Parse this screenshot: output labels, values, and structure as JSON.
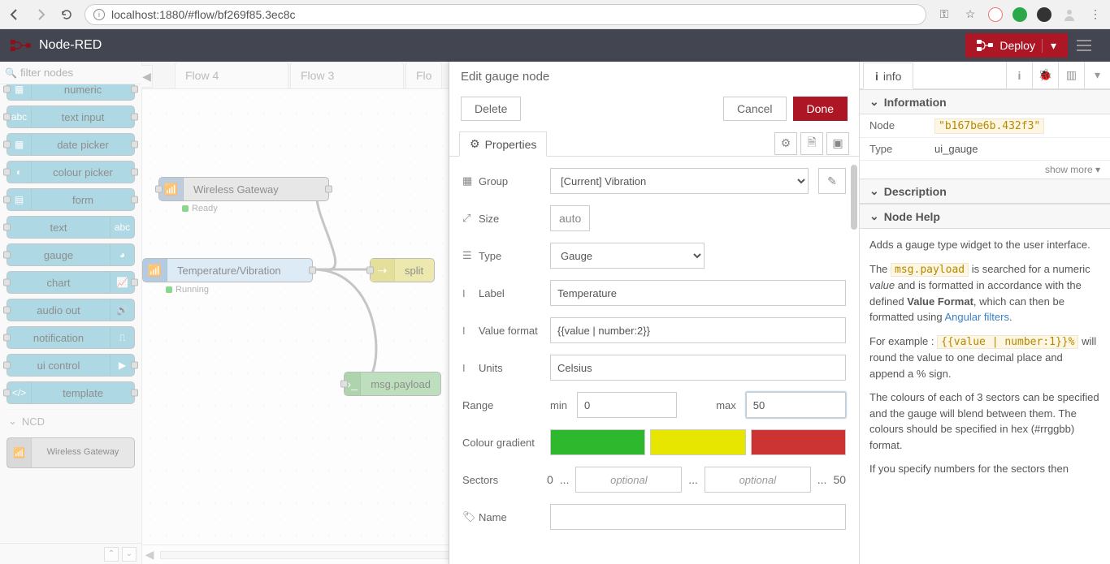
{
  "browser": {
    "url": "localhost:1880/#flow/bf269f85.3ec8c"
  },
  "header": {
    "title": "Node-RED",
    "deploy": "Deploy"
  },
  "palette": {
    "filter_placeholder": "filter nodes",
    "items": [
      {
        "label": "numeric"
      },
      {
        "label": "text input"
      },
      {
        "label": "date picker"
      },
      {
        "label": "colour picker"
      },
      {
        "label": "form"
      },
      {
        "label": "text"
      },
      {
        "label": "gauge"
      },
      {
        "label": "chart"
      },
      {
        "label": "audio out"
      },
      {
        "label": "notification"
      },
      {
        "label": "ui control"
      },
      {
        "label": "template"
      }
    ],
    "cat_ncd": "NCD",
    "ncd_item": "Wireless Gateway"
  },
  "tabs": [
    {
      "label": "Flow 4"
    },
    {
      "label": "Flow 3"
    },
    {
      "label": "Flo"
    }
  ],
  "flow_nodes": {
    "gateway": {
      "label": "Wireless Gateway",
      "status": "Ready"
    },
    "temp": {
      "label": "Temperature/Vibration",
      "status": "Running"
    },
    "split": {
      "label": "split"
    },
    "msgpayload": {
      "label": "msg.payload"
    }
  },
  "tray": {
    "title": "Edit gauge node",
    "delete": "Delete",
    "cancel": "Cancel",
    "done": "Done",
    "properties": "Properties",
    "fields": {
      "group_label": "Group",
      "group_value": "[Current] Vibration",
      "size_label": "Size",
      "size_value": "auto",
      "type_label": "Type",
      "type_value": "Gauge",
      "label_label": "Label",
      "label_value": "Temperature",
      "vf_label": "Value format",
      "vf_value": "{{value | number:2}}",
      "units_label": "Units",
      "units_value": "Celsius",
      "range_label": "Range",
      "min_label": "min",
      "min_value": "0",
      "max_label": "max",
      "max_value": "50",
      "cg_label": "Colour gradient",
      "colors": [
        "#2eb82e",
        "#e6e600",
        "#cc3333"
      ],
      "sectors_label": "Sectors",
      "sectors_start": "0",
      "sectors_end": "50",
      "sectors_placeholder": "optional",
      "name_label": "Name"
    }
  },
  "sidebar": {
    "tab_info": "info",
    "sec_info": "Information",
    "node_k": "Node",
    "node_v": "\"b167be6b.432f3\"",
    "type_k": "Type",
    "type_v": "ui_gauge",
    "showmore": "show more",
    "sec_desc": "Description",
    "sec_help": "Node Help",
    "help": {
      "p1": "Adds a gauge type widget to the user interface.",
      "p2a": "The ",
      "p2code": "msg.payload",
      "p2b": " is searched for a numeric ",
      "p2i": "value",
      "p2c": " and is formatted in accordance with the defined ",
      "p2bold": "Value Format",
      "p2d": ", which can then be formatted using ",
      "p2link": "Angular filters",
      "p3a": "For example : ",
      "p3code": "{{value | number:1}}%",
      "p3b": " will round the value to one decimal place and append a % sign.",
      "p4": "The colours of each of 3 sectors can be specified and the gauge will blend between them. The colours should be specified in hex (#rrggbb) format.",
      "p5": "If you specify numbers for the sectors then"
    }
  }
}
